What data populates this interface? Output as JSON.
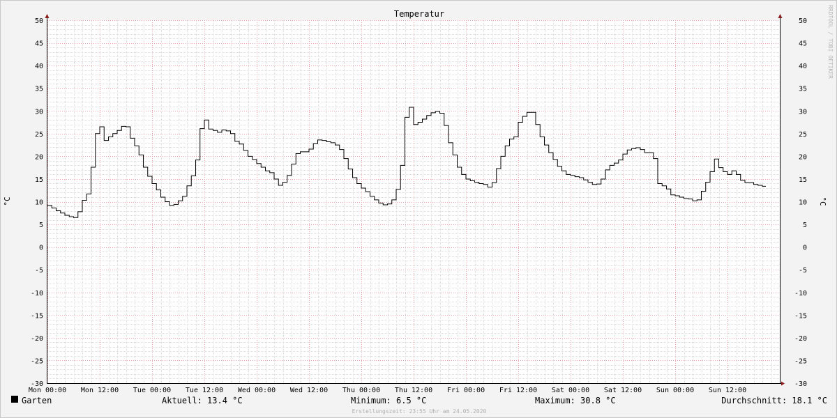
{
  "chart_data": {
    "type": "line",
    "title": "Temperatur",
    "ylabel": "°C",
    "ylabel_right": "°C",
    "ylim": [
      -30,
      50
    ],
    "yticks": [
      50,
      45,
      40,
      35,
      30,
      25,
      20,
      15,
      10,
      5,
      0,
      -5,
      -10,
      -15,
      -20,
      -25,
      -30
    ],
    "xlim_hours": [
      0,
      168
    ],
    "xtick_labels": [
      "Mon 00:00",
      "Mon 12:00",
      "Tue 00:00",
      "Tue 12:00",
      "Wed 00:00",
      "Wed 12:00",
      "Thu 00:00",
      "Thu 12:00",
      "Fri 00:00",
      "Fri 12:00",
      "Sat 00:00",
      "Sat 12:00",
      "Sun 00:00",
      "Sun 12:00"
    ],
    "grid": true,
    "line_style": "step",
    "series": [
      {
        "name": "Garten",
        "color": "#000000",
        "points": [
          [
            0,
            9.2
          ],
          [
            1,
            8.6
          ],
          [
            2,
            8.0
          ],
          [
            3,
            7.5
          ],
          [
            4,
            7.0
          ],
          [
            5,
            6.7
          ],
          [
            6,
            6.5
          ],
          [
            7,
            7.8
          ],
          [
            8,
            10.3
          ],
          [
            9,
            11.7
          ],
          [
            10,
            17.6
          ],
          [
            11,
            25.0
          ],
          [
            12,
            26.5
          ],
          [
            13,
            23.5
          ],
          [
            14,
            24.3
          ],
          [
            15,
            25.0
          ],
          [
            16,
            25.7
          ],
          [
            17,
            26.6
          ],
          [
            18,
            26.5
          ],
          [
            19,
            24.0
          ],
          [
            20,
            22.3
          ],
          [
            21,
            20.3
          ],
          [
            22,
            17.6
          ],
          [
            23,
            15.6
          ],
          [
            24,
            14.0
          ],
          [
            25,
            12.6
          ],
          [
            26,
            11.0
          ],
          [
            27,
            10.0
          ],
          [
            28,
            9.2
          ],
          [
            29,
            9.4
          ],
          [
            30,
            10.2
          ],
          [
            31,
            11.2
          ],
          [
            32,
            13.5
          ],
          [
            33,
            15.7
          ],
          [
            34,
            19.2
          ],
          [
            35,
            26.1
          ],
          [
            36,
            28.0
          ],
          [
            37,
            26.0
          ],
          [
            38,
            25.7
          ],
          [
            39,
            25.3
          ],
          [
            40,
            25.8
          ],
          [
            41,
            25.6
          ],
          [
            42,
            25.0
          ],
          [
            43,
            23.3
          ],
          [
            44,
            22.7
          ],
          [
            45,
            21.3
          ],
          [
            46,
            20.0
          ],
          [
            47,
            19.3
          ],
          [
            48,
            18.4
          ],
          [
            49,
            17.6
          ],
          [
            50,
            16.8
          ],
          [
            51,
            16.4
          ],
          [
            52,
            15.0
          ],
          [
            53,
            13.6
          ],
          [
            54,
            14.3
          ],
          [
            55,
            15.8
          ],
          [
            56,
            18.3
          ],
          [
            57,
            20.6
          ],
          [
            58,
            21.0
          ],
          [
            59,
            21.0
          ],
          [
            60,
            21.6
          ],
          [
            61,
            22.8
          ],
          [
            62,
            23.6
          ],
          [
            63,
            23.5
          ],
          [
            64,
            23.2
          ],
          [
            65,
            23.0
          ],
          [
            66,
            22.5
          ],
          [
            67,
            21.5
          ],
          [
            68,
            19.5
          ],
          [
            69,
            17.2
          ],
          [
            70,
            15.3
          ],
          [
            71,
            14.0
          ],
          [
            72,
            13.0
          ],
          [
            73,
            12.2
          ],
          [
            74,
            11.2
          ],
          [
            75,
            10.4
          ],
          [
            76,
            9.7
          ],
          [
            77,
            9.3
          ],
          [
            78,
            9.5
          ],
          [
            79,
            10.4
          ],
          [
            80,
            12.7
          ],
          [
            81,
            18.0
          ],
          [
            82,
            28.6
          ],
          [
            83,
            30.8
          ],
          [
            84,
            27.0
          ],
          [
            85,
            27.5
          ],
          [
            86,
            28.2
          ],
          [
            87,
            29.0
          ],
          [
            88,
            29.6
          ],
          [
            89,
            29.9
          ],
          [
            90,
            29.5
          ],
          [
            91,
            26.8
          ],
          [
            92,
            23.0
          ],
          [
            93,
            20.3
          ],
          [
            94,
            17.6
          ],
          [
            95,
            16.0
          ],
          [
            96,
            15.0
          ],
          [
            97,
            14.6
          ],
          [
            98,
            14.3
          ],
          [
            99,
            14.0
          ],
          [
            100,
            13.8
          ],
          [
            101,
            13.2
          ],
          [
            102,
            14.2
          ],
          [
            103,
            17.3
          ],
          [
            104,
            20.0
          ],
          [
            105,
            22.3
          ],
          [
            106,
            23.8
          ],
          [
            107,
            24.3
          ],
          [
            108,
            27.5
          ],
          [
            109,
            28.8
          ],
          [
            110,
            29.7
          ],
          [
            111,
            29.7
          ],
          [
            112,
            27.0
          ],
          [
            113,
            24.3
          ],
          [
            114,
            22.5
          ],
          [
            115,
            20.8
          ],
          [
            116,
            19.3
          ],
          [
            117,
            17.8
          ],
          [
            118,
            16.8
          ],
          [
            119,
            16.0
          ],
          [
            120,
            15.8
          ],
          [
            121,
            15.5
          ],
          [
            122,
            15.3
          ],
          [
            123,
            14.8
          ],
          [
            124,
            14.3
          ],
          [
            125,
            13.8
          ],
          [
            126,
            13.9
          ],
          [
            127,
            15.0
          ],
          [
            128,
            17.0
          ],
          [
            129,
            18.0
          ],
          [
            130,
            18.5
          ],
          [
            131,
            19.2
          ],
          [
            132,
            20.5
          ],
          [
            133,
            21.4
          ],
          [
            134,
            21.7
          ],
          [
            135,
            21.9
          ],
          [
            136,
            21.5
          ],
          [
            137,
            20.8
          ],
          [
            138,
            20.8
          ],
          [
            139,
            19.5
          ],
          [
            140,
            14.0
          ],
          [
            141,
            13.5
          ],
          [
            142,
            12.8
          ],
          [
            143,
            11.5
          ],
          [
            144,
            11.3
          ],
          [
            145,
            11.0
          ],
          [
            146,
            10.7
          ],
          [
            147,
            10.6
          ],
          [
            148,
            10.2
          ],
          [
            149,
            10.4
          ],
          [
            150,
            12.3
          ],
          [
            151,
            14.3
          ],
          [
            152,
            16.6
          ],
          [
            153,
            19.4
          ],
          [
            154,
            17.5
          ],
          [
            155,
            16.6
          ],
          [
            156,
            16.0
          ],
          [
            157,
            16.8
          ],
          [
            158,
            16.0
          ],
          [
            159,
            14.7
          ],
          [
            160,
            14.2
          ],
          [
            161,
            14.2
          ],
          [
            162,
            13.8
          ],
          [
            163,
            13.6
          ],
          [
            164,
            13.4
          ]
        ]
      }
    ]
  },
  "legend": {
    "series_name": "Garten",
    "current": "Aktuell: 13.4 °C",
    "minimum": "Minimum: 6.5 °C",
    "maximum": "Maximum: 30.8 °C",
    "average": "Durchschnitt: 18.1 °C"
  },
  "watermark": "RRDTOOL / TOBI OETIKER",
  "footer": "Erstellungszeit: 23:55 Uhr am 24.05.2020"
}
